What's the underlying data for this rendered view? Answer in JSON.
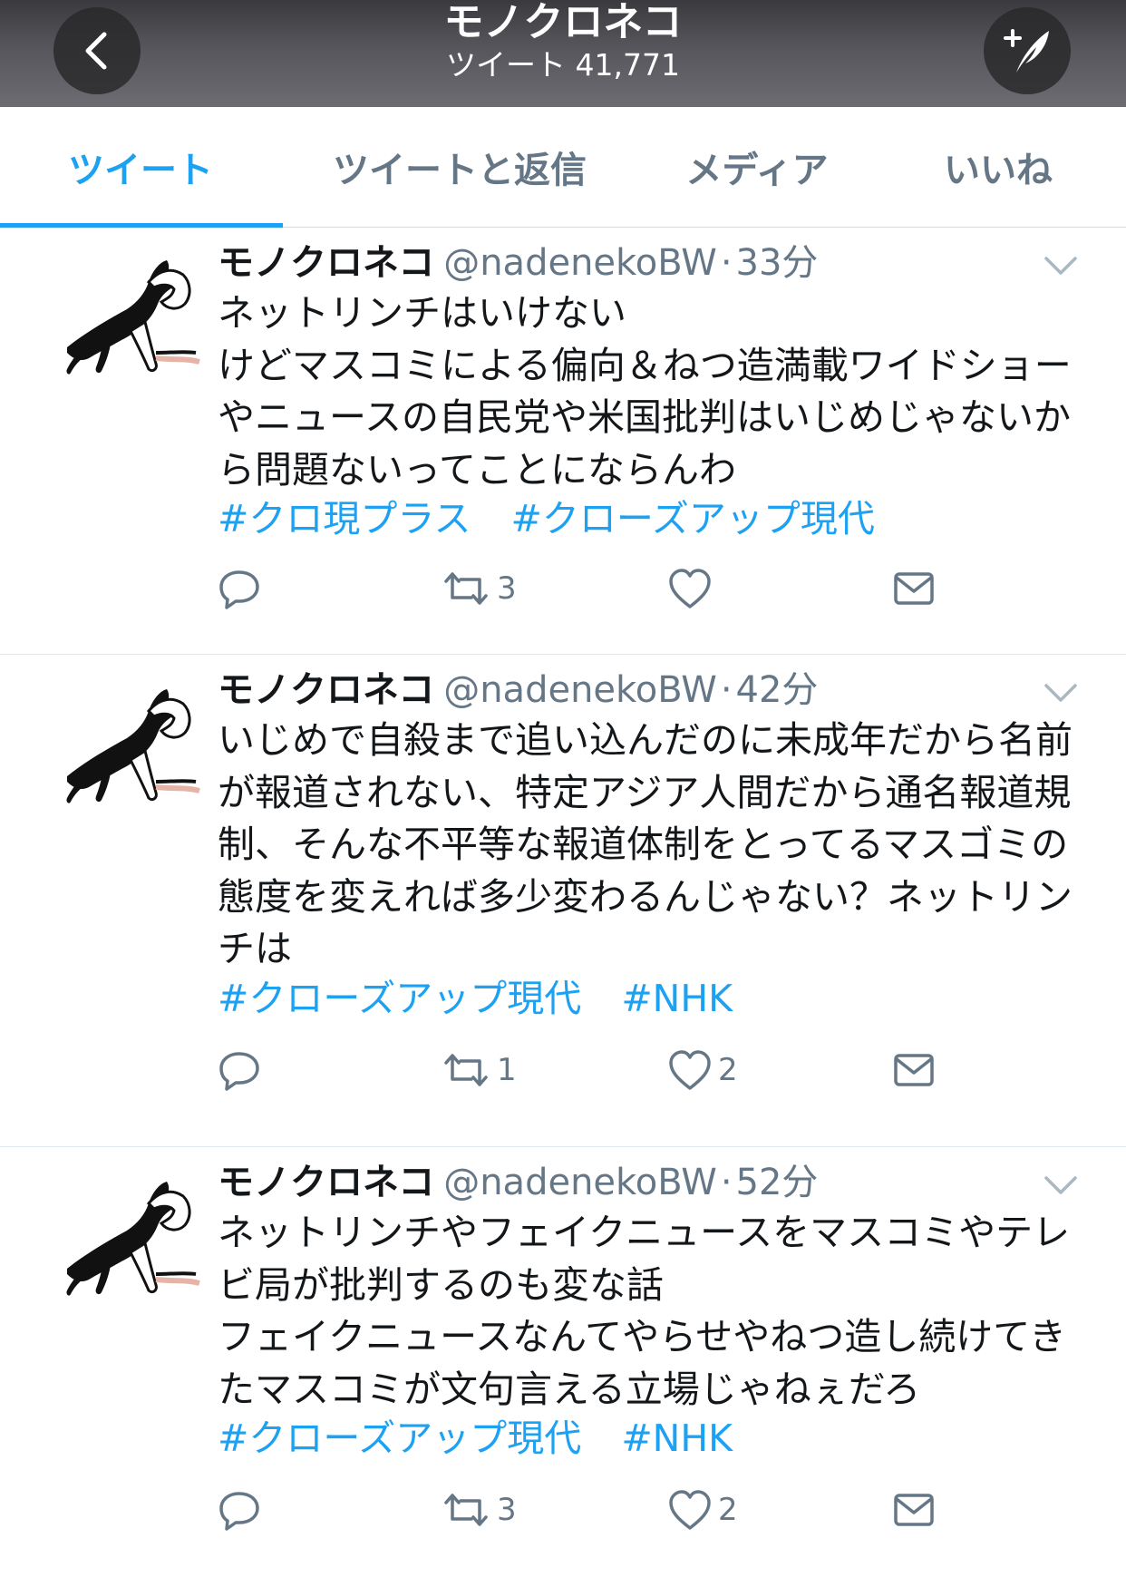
{
  "header": {
    "title": "モノクロネコ",
    "subtitle": "ツイート 41,771"
  },
  "tabs": [
    {
      "label": "ツイート",
      "active": true
    },
    {
      "label": "ツイートと返信",
      "active": false
    },
    {
      "label": "メディア",
      "active": false
    },
    {
      "label": "いいね",
      "active": false
    }
  ],
  "colors": {
    "accent": "#1da1f2",
    "secondary_text": "#657786"
  },
  "tweets": [
    {
      "name": "モノクロネコ",
      "handle": "@nadenekoBW",
      "dot": "·",
      "time": "33分",
      "text": "ネットリンチはいけない\nけどマスコミによる偏向＆ねつ造満載ワイドショーやニュースの自民党や米国批判はいじめじゃないから問題ないってことにならんわ",
      "hashtags": [
        "#クロ現プラス",
        "#クローズアップ現代"
      ],
      "replies": "",
      "retweets": "3",
      "likes": ""
    },
    {
      "name": "モノクロネコ",
      "handle": "@nadenekoBW",
      "dot": "·",
      "time": "42分",
      "text": "いじめで自殺まで追い込んだのに未成年だから名前が報道されない、特定アジア人間だから通名報道規制、そんな不平等な報道体制をとってるマスゴミの態度を変えれば多少変わるんじゃない？ネットリンチは",
      "hashtags": [
        "#クローズアップ現代",
        "#NHK"
      ],
      "replies": "",
      "retweets": "1",
      "likes": "2"
    },
    {
      "name": "モノクロネコ",
      "handle": "@nadenekoBW",
      "dot": "·",
      "time": "52分",
      "text": "ネットリンチやフェイクニュースをマスコミやテレビ局が批判するのも変な話\nフェイクニュースなんてやらせやねつ造し続けてきたマスコミが文句言える立場じゃねぇだろ",
      "hashtags": [
        "#クローズアップ現代",
        "#NHK"
      ],
      "replies": "",
      "retweets": "3",
      "likes": "2"
    }
  ]
}
